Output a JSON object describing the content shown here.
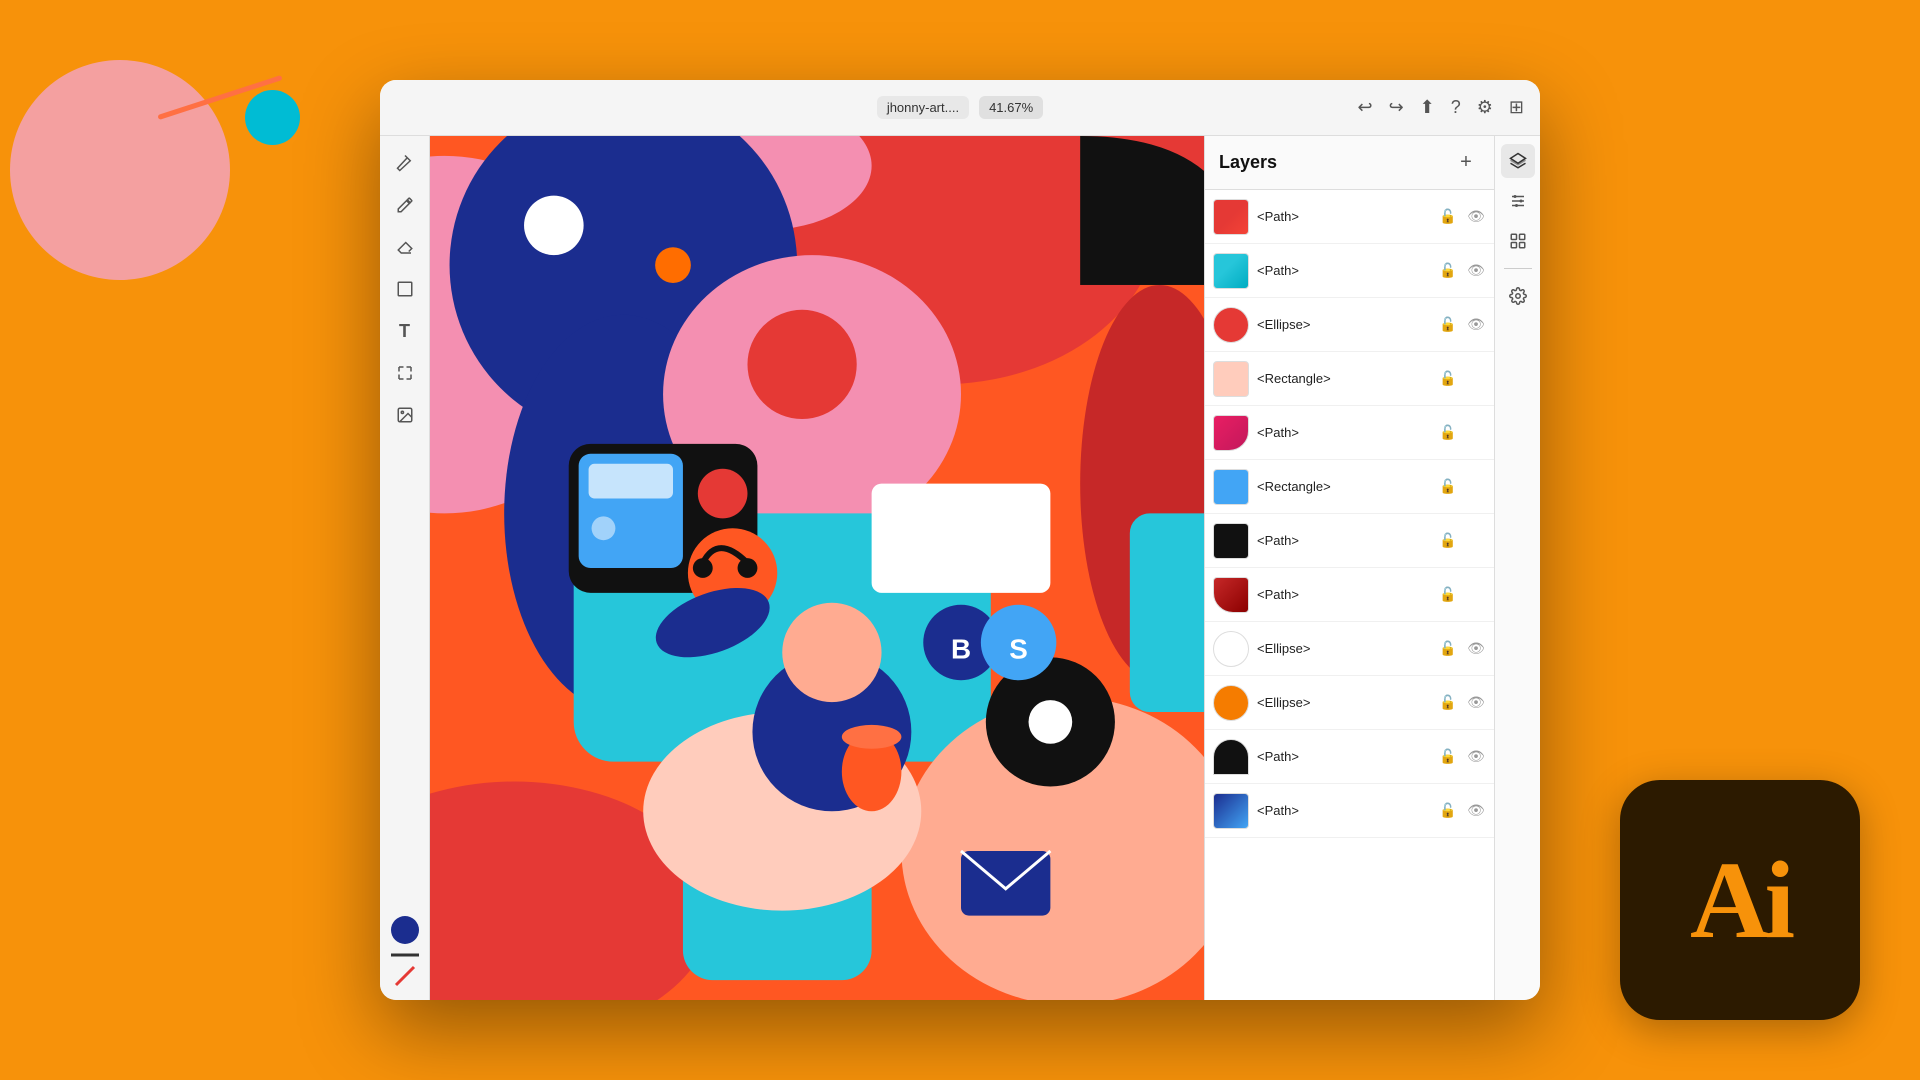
{
  "background_color": "#F7920A",
  "app": {
    "title": "Adobe Illustrator",
    "file_name": "jhonny-art....",
    "zoom": "41.67%"
  },
  "toolbar": {
    "left_tools": [
      "pen",
      "pencil",
      "eraser",
      "rectangle",
      "text",
      "transform",
      "image",
      "swatch",
      "divider",
      "stroke"
    ]
  },
  "layers_panel": {
    "title": "Layers",
    "add_button": "+",
    "items": [
      {
        "name": "<Path>",
        "color": "#E53935",
        "shape": "path"
      },
      {
        "name": "<Path>",
        "color": "#42A5F5",
        "shape": "path"
      },
      {
        "name": "<Ellipse>",
        "color": "#E53935",
        "shape": "ellipse"
      },
      {
        "name": "<Rectangle>",
        "color": "#FFCCBC",
        "shape": "rectangle"
      },
      {
        "name": "<Path>",
        "color": "#E91E63",
        "shape": "path"
      },
      {
        "name": "<Rectangle>",
        "color": "#42A5F5",
        "shape": "rectangle"
      },
      {
        "name": "<Path>",
        "color": "#111111",
        "shape": "path"
      },
      {
        "name": "<Path>",
        "color": "#C62828",
        "shape": "path"
      },
      {
        "name": "<Ellipse>",
        "color": "#FFFFFF",
        "shape": "ellipse"
      },
      {
        "name": "<Ellipse>",
        "color": "#F57C00",
        "shape": "ellipse"
      },
      {
        "name": "<Path>",
        "color": "#111111",
        "shape": "path"
      },
      {
        "name": "<Path>",
        "color": "#42A5F5",
        "shape": "path"
      }
    ]
  },
  "right_panel": {
    "icons": [
      "layers",
      "properties",
      "libraries",
      "separator",
      "settings"
    ]
  },
  "title_bar_icons": [
    "undo",
    "redo",
    "share",
    "help",
    "settings",
    "arrange"
  ],
  "ai_logo": {
    "text": "Ai",
    "bg_color": "#2C1A00",
    "text_color": "#F7920A"
  },
  "badges": [
    {
      "letter": "B",
      "color": "#1B2D8F"
    },
    {
      "letter": "S",
      "color": "#42A5F5"
    }
  ]
}
